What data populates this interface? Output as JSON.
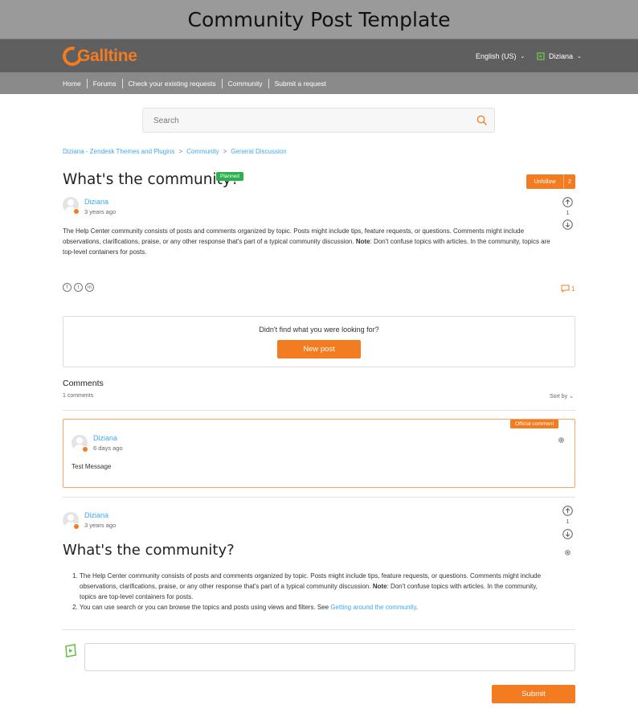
{
  "page_title": "Community Post Template",
  "brand": {
    "logo_text": "Galltine",
    "accent": "#f47c20",
    "link": "#3fa9f5"
  },
  "header": {
    "language": "English (US)",
    "user": "Diziana"
  },
  "nav": [
    "Home",
    "Forums",
    "Check your existing requests",
    "Community",
    "Submit a request"
  ],
  "search": {
    "placeholder": "Search"
  },
  "breadcrumb": [
    "Diziana - Zendesk Themes and Plugins",
    "Community",
    "General Discussion"
  ],
  "post": {
    "title": "What's the community?",
    "status": "Planned",
    "unfollow_label": "Unfollow",
    "follower_count": "2",
    "author": "Diziana",
    "time": "3 years ago",
    "votes": "1",
    "body_before_note": "The Help Center community consists of posts and comments organized by topic. Posts might include tips, feature requests, or questions. Comments might include observations, clarifications, praise, or any other response that's part of a typical community discussion. ",
    "note_label": "Note",
    "body_after_note": ": Don't confuse topics with articles. In the community, topics are top-level containers for posts.",
    "comment_count": "1"
  },
  "new_post": {
    "question": "Didn't find what you were looking for?",
    "button": "New post"
  },
  "comments": {
    "heading": "Comments",
    "count_label": "1 comments",
    "sort_label": "Sort by",
    "official": {
      "badge": "Official comment",
      "author": "Diziana",
      "time": "6 days ago",
      "message": "Test Message"
    },
    "second": {
      "author": "Diziana",
      "time": "3 years ago",
      "votes": "1",
      "title": "What's the community?",
      "item1_before_note": "The Help Center community consists of posts and comments organized by topic. Posts might include tips, feature requests, or questions. Comments might include observations, clarifications, praise, or any other response that's part of a typical community discussion. ",
      "item1_note": "Note",
      "item1_after_note": ": Don't confuse topics with articles. In the community, topics are top-level containers for posts.",
      "item2_text": "You can use search or you can browse the topics and posts using views and filters. See ",
      "item2_link": "Getting around the community",
      "item2_end": "."
    }
  },
  "reply": {
    "submit": "Submit"
  }
}
